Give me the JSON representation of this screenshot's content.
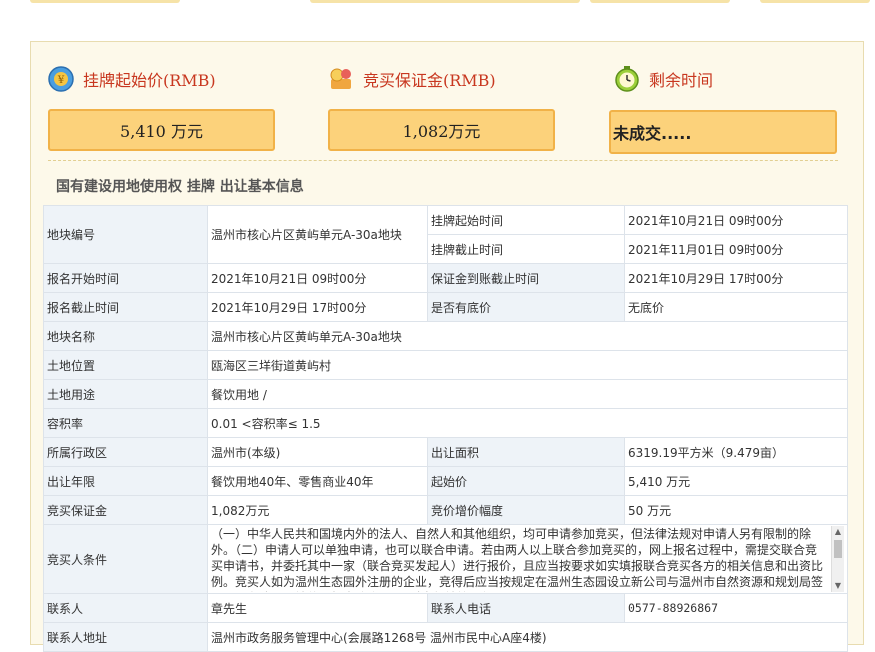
{
  "price": {
    "start_label": "挂牌起始价(RMB)",
    "start_value": "5,410 万元",
    "deposit_label": "竞买保证金(RMB)",
    "deposit_value": "1,082万元",
    "remain_label": "剩余时间",
    "remain_value": "未成交....."
  },
  "section_title": "国有建设用地使用权 挂牌 出让基本信息",
  "rows": {
    "plot_no_label": "地块编号",
    "plot_no_value": "温州市核心片区黄屿单元A-30a地块",
    "list_start_label": "挂牌起始时间",
    "list_start_value": "2021年10月21日 09时00分",
    "list_end_label": "挂牌截止时间",
    "list_end_value": "2021年11月01日 09时00分",
    "reg_start_label": "报名开始时间",
    "reg_start_value": "2021年10月21日 09时00分",
    "deposit_deadline_label": "保证金到账截止时间",
    "deposit_deadline_value": "2021年10月29日 17时00分",
    "reg_end_label": "报名截止时间",
    "reg_end_value": "2021年10月29日 17时00分",
    "reserve_label": "是否有底价",
    "reserve_value": "无底价",
    "plot_name_label": "地块名称",
    "plot_name_value": "温州市核心片区黄屿单元A-30a地块",
    "location_label": "土地位置",
    "location_value": "瓯海区三垟街道黄屿村",
    "use_label": "土地用途",
    "use_value": "餐饮用地 /",
    "far_label": "容积率",
    "far_value": "0.01 <容积率≤ 1.5",
    "district_label": "所属行政区",
    "district_value": "温州市(本级)",
    "area_label": "出让面积",
    "area_value": "6319.19平方米（9.479亩）",
    "term_label": "出让年限",
    "term_value": "餐饮用地40年、零售商业40年",
    "start_price_label": "起始价",
    "start_price_value": "5,410 万元",
    "deposit_label": "竞买保证金",
    "deposit_value": "1,082万元",
    "increment_label": "竞价增价幅度",
    "increment_value": "50 万元",
    "bidder_label": "竞买人条件",
    "bidder_text": "（一）中华人民共和国境内外的法人、自然人和其他组织，均可申请参加竞买，但法律法规对申请人另有限制的除外。（二）申请人可以单独申请，也可以联合申请。若由两人以上联合参加竞买的，网上报名过程中，需提交联合竞买申请书，并委托其中一家（联合竞买发起人）进行报价，且应当按要求如实填报联合竞买各方的相关信息和出资比例。竞买人如为温州生态园外注册的企业，竞得后应当按规定在温州生态园设立新公司与温州市自然资源和规划局签订《国有建设用地使用权出让合同》，对竞得地块进行开",
    "contact_label": "联系人",
    "contact_value": "章先生",
    "phone_label": "联系人电话",
    "phone_value": "0577-88926867",
    "address_label": "联系人地址",
    "address_value": "温州市政务服务管理中心(会展路1268号 温州市民中心A座4楼)"
  }
}
